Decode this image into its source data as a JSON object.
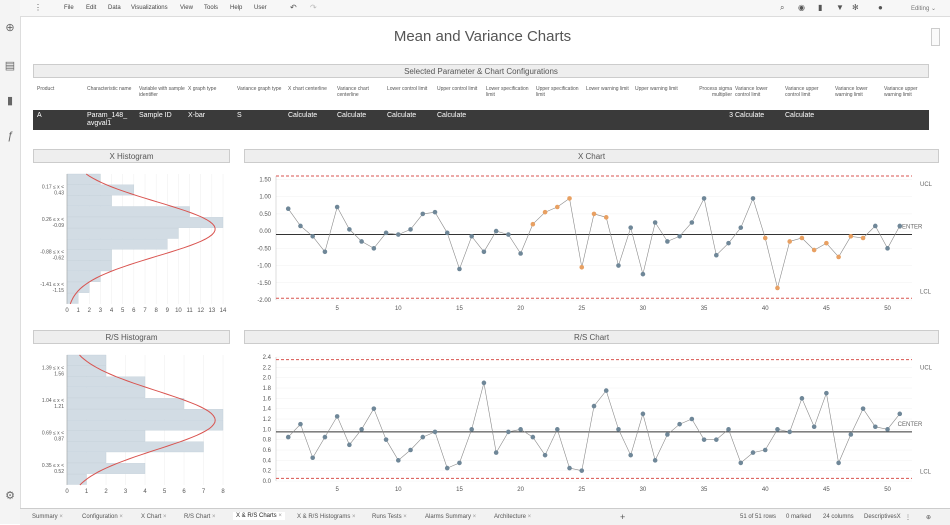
{
  "menu": [
    "File",
    "Edit",
    "Data",
    "Visualizations",
    "View",
    "Tools",
    "Help",
    "User"
  ],
  "mode_label": "Editing",
  "page_title": "Mean and Variance Charts",
  "config": {
    "title": "Selected Parameter & Chart Configurations",
    "headers": [
      "Product",
      "Characteristic name",
      "Variable with sample identifier",
      "X graph type",
      "Variance graph type",
      "X chart centerline",
      "Variance chart centerline",
      "Lower control limit",
      "Upper control limit",
      "Lower specification limit",
      "Upper specification limit",
      "Lower warning limit",
      "Upper warning limit",
      "Process sigma multiplier",
      "Variance lower control limit",
      "Variance upper control limit",
      "Variance lower warning limit",
      "Variance upper warning limit"
    ],
    "row": [
      "A",
      "Param_148_ avgval1",
      "Sample ID",
      "X-bar",
      "S",
      "Calculate",
      "Calculate",
      "Calculate",
      "Calculate",
      "",
      "",
      "",
      "",
      "3",
      "Calculate",
      "Calculate",
      "",
      ""
    ]
  },
  "panels": {
    "x_hist": "X Histogram",
    "x_chart": "X Chart",
    "rs_hist": "R/S Histogram",
    "rs_chart": "R/S Chart"
  },
  "chart_data": [
    {
      "type": "bar",
      "orientation": "horizontal",
      "title": "X Histogram",
      "y_tick_labels": [
        "0.17 ≤ x < 0.43",
        "0.26 ≤ x < -0.09",
        "-0.88 ≤ x < -0.62",
        "-1.41 ≤ x < -1.15"
      ],
      "values": [
        3,
        6,
        4,
        11,
        14,
        10,
        9,
        4,
        4,
        3,
        2,
        1
      ],
      "xlim": [
        0,
        14
      ],
      "x_ticks": [
        0,
        1,
        2,
        3,
        4,
        5,
        6,
        7,
        8,
        9,
        10,
        11,
        12,
        13,
        14
      ],
      "overlay": "normal curve"
    },
    {
      "type": "line",
      "title": "X Chart",
      "x_ticks": [
        5,
        10,
        15,
        20,
        25,
        30,
        35,
        40,
        45,
        50
      ],
      "xlim": [
        0,
        52
      ],
      "ylim": [
        -2.0,
        1.6
      ],
      "y_ticks": [
        "1.50",
        "1.00",
        "0.50",
        "0.00",
        "-0.50",
        "-1.00",
        "-1.50",
        "-2.00"
      ],
      "ucl": 1.6,
      "lcl": -1.95,
      "center": -0.1,
      "labels": {
        "ucl": "UCL",
        "lcl": "LCL",
        "center": "CENTER"
      },
      "x": [
        1,
        2,
        3,
        4,
        5,
        6,
        7,
        8,
        9,
        10,
        11,
        12,
        13,
        14,
        15,
        16,
        17,
        18,
        19,
        20,
        21,
        22,
        23,
        24,
        25,
        26,
        27,
        28,
        29,
        30,
        31,
        32,
        33,
        34,
        35,
        36,
        37,
        38,
        39,
        40,
        41,
        42,
        43,
        44,
        45,
        46,
        47,
        48,
        49,
        50,
        51
      ],
      "values": [
        0.65,
        0.15,
        -0.15,
        -0.6,
        0.7,
        0.05,
        -0.3,
        -0.5,
        -0.05,
        -0.1,
        0.05,
        0.5,
        0.55,
        -0.05,
        -1.1,
        -0.15,
        -0.6,
        0.0,
        -0.1,
        -0.65,
        0.2,
        0.55,
        0.7,
        0.95,
        -1.05,
        0.5,
        0.4,
        -1.0,
        0.1,
        -1.25,
        0.25,
        -0.3,
        -0.15,
        0.25,
        0.95,
        -0.7,
        -0.35,
        0.1,
        0.95,
        -0.2,
        -1.65,
        -0.3,
        -0.2,
        -0.55,
        -0.35,
        -0.75,
        -0.15,
        -0.2,
        0.15,
        -0.5,
        0.15
      ],
      "highlighted_x": [
        21,
        22,
        23,
        24,
        25,
        26,
        27,
        40,
        41,
        42,
        43,
        44,
        45,
        46,
        47,
        48
      ],
      "point_colors": {
        "normal": "#6f8798",
        "warning": "#e8a062"
      }
    },
    {
      "type": "bar",
      "orientation": "horizontal",
      "title": "R/S Histogram",
      "y_tick_labels": [
        "1.39 ≤ x < 1.56",
        "1.04 ≤ x < 1.21",
        "0.69 ≤ x < 0.87",
        "0.35 ≤ x < 0.52"
      ],
      "values": [
        2,
        2,
        4,
        4,
        6,
        8,
        8,
        4,
        7,
        2,
        4,
        1
      ],
      "xlim": [
        0,
        8
      ],
      "x_ticks": [
        0,
        1,
        2,
        3,
        4,
        5,
        6,
        7,
        8
      ],
      "overlay": "normal curve"
    },
    {
      "type": "line",
      "title": "R/S Chart",
      "x_ticks": [
        5,
        10,
        15,
        20,
        25,
        30,
        35,
        40,
        45,
        50
      ],
      "xlim": [
        0,
        52
      ],
      "ylim": [
        0,
        2.4
      ],
      "y_ticks": [
        "2.4",
        "2.2",
        "2.0",
        "1.8",
        "1.6",
        "1.4",
        "1.2",
        "1.0",
        "0.8",
        "0.6",
        "0.4",
        "0.2",
        "0.0"
      ],
      "ucl": 2.35,
      "lcl": 0.05,
      "center": 0.95,
      "labels": {
        "ucl": "UCL",
        "lcl": "LCL",
        "center": "CENTER"
      },
      "x": [
        1,
        2,
        3,
        4,
        5,
        6,
        7,
        8,
        9,
        10,
        11,
        12,
        13,
        14,
        15,
        16,
        17,
        18,
        19,
        20,
        21,
        22,
        23,
        24,
        25,
        26,
        27,
        28,
        29,
        30,
        31,
        32,
        33,
        34,
        35,
        36,
        37,
        38,
        39,
        40,
        41,
        42,
        43,
        44,
        45,
        46,
        47,
        48,
        49,
        50,
        51
      ],
      "values": [
        0.85,
        1.1,
        0.45,
        0.85,
        1.25,
        0.7,
        1.0,
        1.4,
        0.8,
        0.4,
        0.6,
        0.85,
        0.95,
        0.25,
        0.35,
        1.0,
        1.9,
        0.55,
        0.95,
        1.0,
        0.85,
        0.5,
        1.0,
        0.25,
        0.2,
        1.45,
        1.75,
        1.0,
        0.5,
        1.3,
        0.4,
        0.9,
        1.1,
        1.2,
        0.8,
        0.8,
        1.0,
        0.35,
        0.55,
        0.6,
        1.0,
        0.95,
        1.6,
        1.05,
        1.7,
        0.35,
        0.9,
        1.4,
        1.05,
        1.0,
        1.3
      ]
    }
  ],
  "tabs": [
    "Summary",
    "Configuration",
    "X Chart",
    "R/S Chart",
    "X & R/S Charts",
    "X & R/S Histograms",
    "Runs Tests",
    "Alarms Summary",
    "Architecture"
  ],
  "status": {
    "rows": "51 of 51 rows",
    "marked": "0 marked",
    "columns": "24 columns",
    "table": "DescriptivesX"
  }
}
